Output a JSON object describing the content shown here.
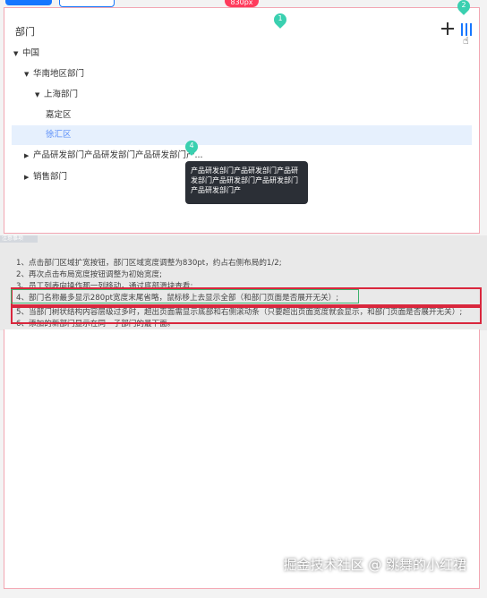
{
  "header": {
    "width_badge": "830px"
  },
  "panel": {
    "title": "部门",
    "add_icon": "plus-icon",
    "expand_icon": "column-expand-icon"
  },
  "tree": {
    "root": "中国",
    "south": "华南地区部门",
    "shanghai": "上海部门",
    "jiading": "嘉定区",
    "xuhui": "徐汇区",
    "product": "产品研发部门产品研发部门产品研发部门产...",
    "sales": "销售部门"
  },
  "markers": {
    "m1": "1",
    "m2": "2",
    "m4": "4"
  },
  "tooltip": {
    "line1": "产品研发部门产品研发部门产品研",
    "line2": "发部门产品研发部门产品研发部门",
    "line3": "产品研发部门产"
  },
  "notes": {
    "tab": "注意事项",
    "n1": "1、点击部门区域扩宽按钮，部门区域宽度调整为830pt，约占右侧布局的1/2;",
    "n2": "2、再次点击布局宽度按钮调整为初始宽度;",
    "n3": "3、员工列表向操作那一列移动，通过底部滑块查看;",
    "n4": "4、部门名称最多显示280pt宽度末尾省略，鼠标移上去显示全部（和部门页面是否展开无关）;",
    "n5": "5、当部门树状结构内容层级过多时，超出页面需显示底部和右侧滚动条（只要超出页面宽度就会显示，和部门页面是否展开无关）;",
    "n6": "6、添加的新部门显示在同一子部门的最下面。"
  },
  "watermark": "掘金技术社区 @ 跳舞的小红裙",
  "colors": {
    "accent": "#1677ff",
    "marker": "#3ad0b0",
    "badge": "#ff3b5c",
    "highlight_red": "#d9273d",
    "highlight_green": "#3bb26d"
  }
}
